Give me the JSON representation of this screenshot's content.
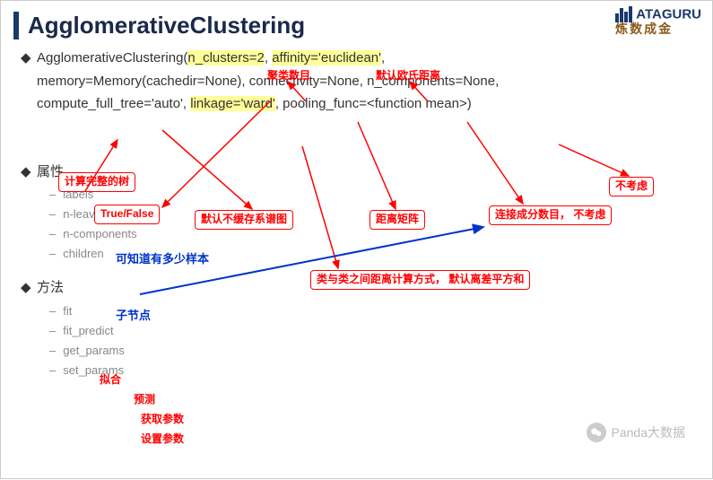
{
  "title": "AgglomerativeClustering",
  "logo": {
    "text1": "ATAGURU",
    "text2": "炼数成金"
  },
  "signature_line1": "AgglomerativeClustering(",
  "sig_nclusters": "n_clusters=2",
  "sig_sep1": ", ",
  "sig_affinity": "affinity='euclidean'",
  "sig_sep2": ",",
  "signature_line2a": "memory=Memory(cachedir=None), connectivity=None, n_components=None,",
  "signature_line3a": "compute_full_tree='auto', ",
  "sig_linkage": "linkage='ward'",
  "signature_line3b": ", pooling_func=<function mean>)",
  "section_attr": "属性",
  "attrs": {
    "a0": "labels",
    "a1": "n-leaves",
    "a2": "n-components",
    "a3": "children"
  },
  "section_method": "方法",
  "methods": {
    "m0": "fit",
    "m1": "fit_predict",
    "m2": "get_params",
    "m3": "set_params"
  },
  "anno": {
    "cluster_num": "聚类数目",
    "default_euclid": "默认欧氏距离",
    "compute_tree": "计算完整的树",
    "true_false": "True/False",
    "no_cache_dendro": "默认不缓存系谱图",
    "dist_matrix": "距离矩阵",
    "conn_components": "连接成分数目，\n不考虑",
    "ignore": "不考虑",
    "linkage_desc": "类与类之间距离计算方式，\n默认离差平方和",
    "samples_known": "可知道有多少样本",
    "child_node": "子节点",
    "fit": "拟合",
    "predict": "预测",
    "get_params": "获取参数",
    "set_params": "设置参数"
  },
  "watermark": "Panda大数据"
}
